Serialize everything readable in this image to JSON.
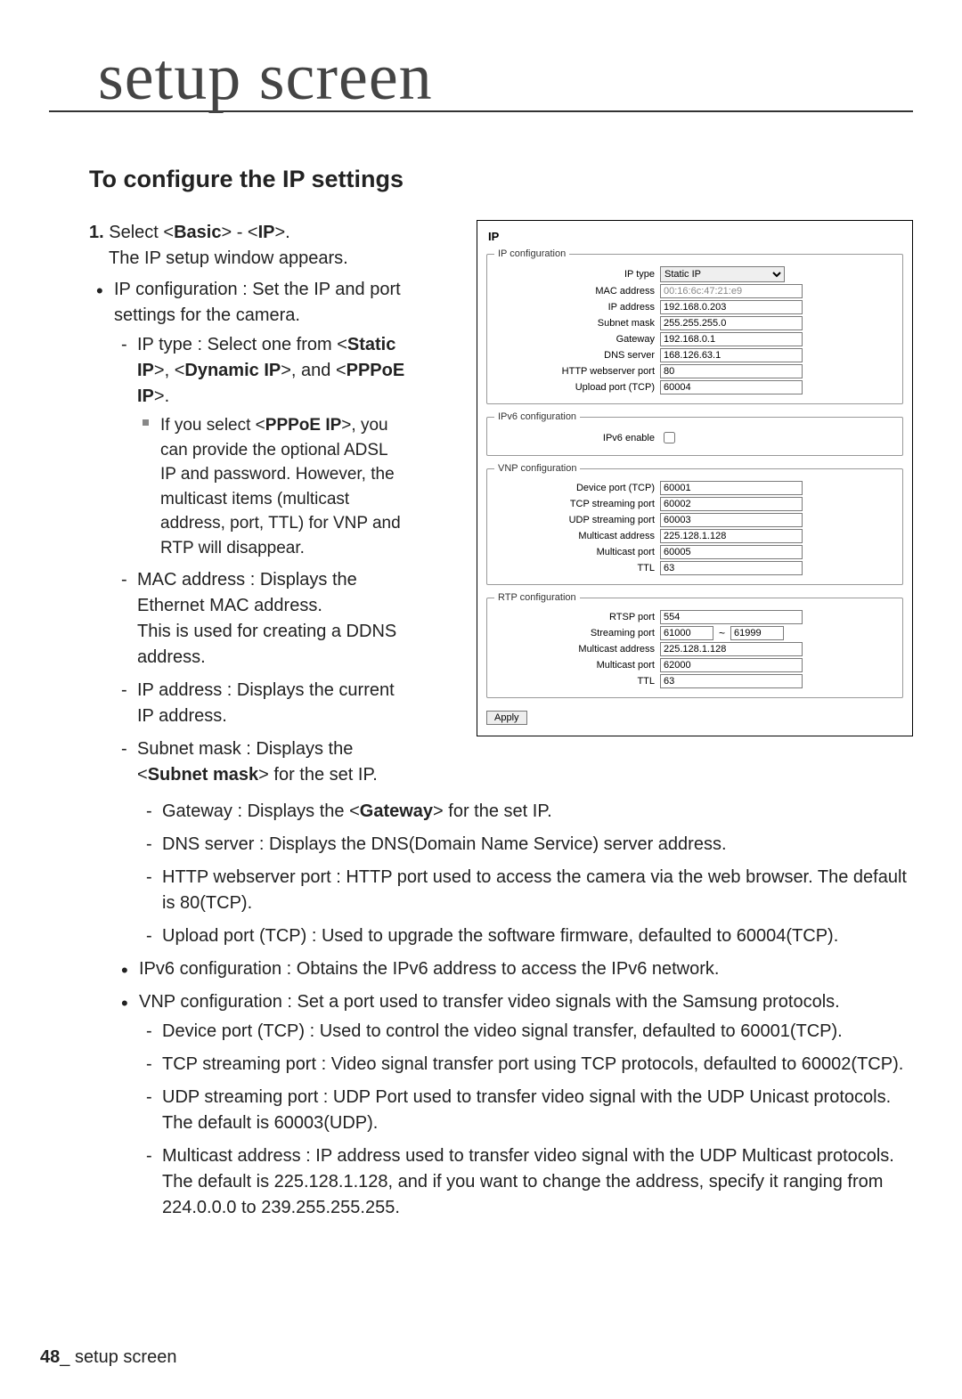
{
  "header_title": "setup screen",
  "section_title": "To configure the IP settings",
  "step1": {
    "prefix": "1.",
    "line_a": "Select <",
    "basic": "Basic",
    "dash": "> - <",
    "ip": "IP",
    "line_b": ">.",
    "line2": "The IP setup window appears."
  },
  "bul_ipconf": "IP configuration : Set the IP and port settings for the camera.",
  "dash_iptype_a": "IP type : Select one from <",
  "static_ip": "Static IP",
  "dash_iptype_b": ">, <",
  "dynamic_ip": "Dynamic IP",
  "dash_iptype_c": ">, and <",
  "pppoe_ip": "PPPoE IP",
  "dash_iptype_d": ">.",
  "sq_pppoe_a": "If you select <",
  "sq_pppoe_b": ">, you can provide the optional ADSL IP and password. However, the multicast items (multicast address, port, TTL) for VNP and RTP will disappear.",
  "dash_mac": "MAC address : Displays the Ethernet MAC address.\nThis is used for creating a DDNS address.",
  "dash_ipaddr": "IP address : Displays the current IP address.",
  "dash_subnet_a": "Subnet mask : Displays the <",
  "subnet_mask": "Subnet mask",
  "dash_subnet_b": "> for the set IP.",
  "dash_gateway_a": "Gateway : Displays the <",
  "gateway": "Gateway",
  "dash_gateway_b": "> for the set IP.",
  "dash_dns": "DNS server : Displays the DNS(Domain Name Service) server address.",
  "dash_http": "HTTP webserver port : HTTP port used to access the camera via the web browser. The default is 80(TCP).",
  "dash_upload": "Upload port (TCP) : Used to upgrade the software firmware, defaulted to 60004(TCP).",
  "bul_ipv6": "IPv6 configuration : Obtains the IPv6 address to access the IPv6 network.",
  "bul_vnp": "VNP configuration : Set a port used to transfer video signals with the Samsung protocols.",
  "dash_devport": "Device port (TCP) : Used to control the video signal transfer, defaulted to 60001(TCP).",
  "dash_tcpstream": "TCP streaming port : Video signal transfer port using TCP protocols, defaulted to 60002(TCP).",
  "dash_udpstream": "UDP streaming port : UDP Port used to transfer video signal with the UDP Unicast protocols. The default is 60003(UDP).",
  "dash_multi": "Multicast address : IP address used to transfer video signal with the UDP Multicast protocols.\nThe default is 225.128.1.128, and if you want to change the address, specify it ranging from 224.0.0.0 to 239.255.255.255.",
  "footer_page": "48",
  "footer_sep": "_ ",
  "footer_text": "setup screen",
  "panel": {
    "title": "IP",
    "grp_ip": "IP configuration",
    "iptype_label": "IP type",
    "iptype_value": "Static IP",
    "mac_label": "MAC address",
    "mac_value": "00:16:6c:47:21:e9",
    "ipaddr_label": "IP address",
    "ipaddr_value": "192.168.0.203",
    "subnet_label": "Subnet mask",
    "subnet_value": "255.255.255.0",
    "gateway_label": "Gateway",
    "gateway_value": "192.168.0.1",
    "dns_label": "DNS server",
    "dns_value": "168.126.63.1",
    "http_label": "HTTP webserver port",
    "http_value": "80",
    "upload_label": "Upload port (TCP)",
    "upload_value": "60004",
    "grp_ipv6": "IPv6 configuration",
    "ipv6enable_label": "IPv6 enable",
    "grp_vnp": "VNP configuration",
    "devport_label": "Device port (TCP)",
    "devport_value": "60001",
    "tcpstream_label": "TCP streaming port",
    "tcpstream_value": "60002",
    "udpstream_label": "UDP streaming port",
    "udpstream_value": "60003",
    "multiaddr_label": "Multicast address",
    "multiaddr_value": "225.128.1.128",
    "multiport_label": "Multicast port",
    "multiport_value": "60005",
    "ttl_label": "TTL",
    "ttl_value": "63",
    "grp_rtp": "RTP configuration",
    "rtsp_label": "RTSP port",
    "rtsp_value": "554",
    "stream_label": "Streaming port",
    "stream_value": "61000",
    "stream_tilde": "~",
    "stream_value2": "61999",
    "rtp_multiaddr_value": "225.128.1.128",
    "rtp_multiport_value": "62000",
    "rtp_ttl_value": "63",
    "apply": "Apply"
  }
}
